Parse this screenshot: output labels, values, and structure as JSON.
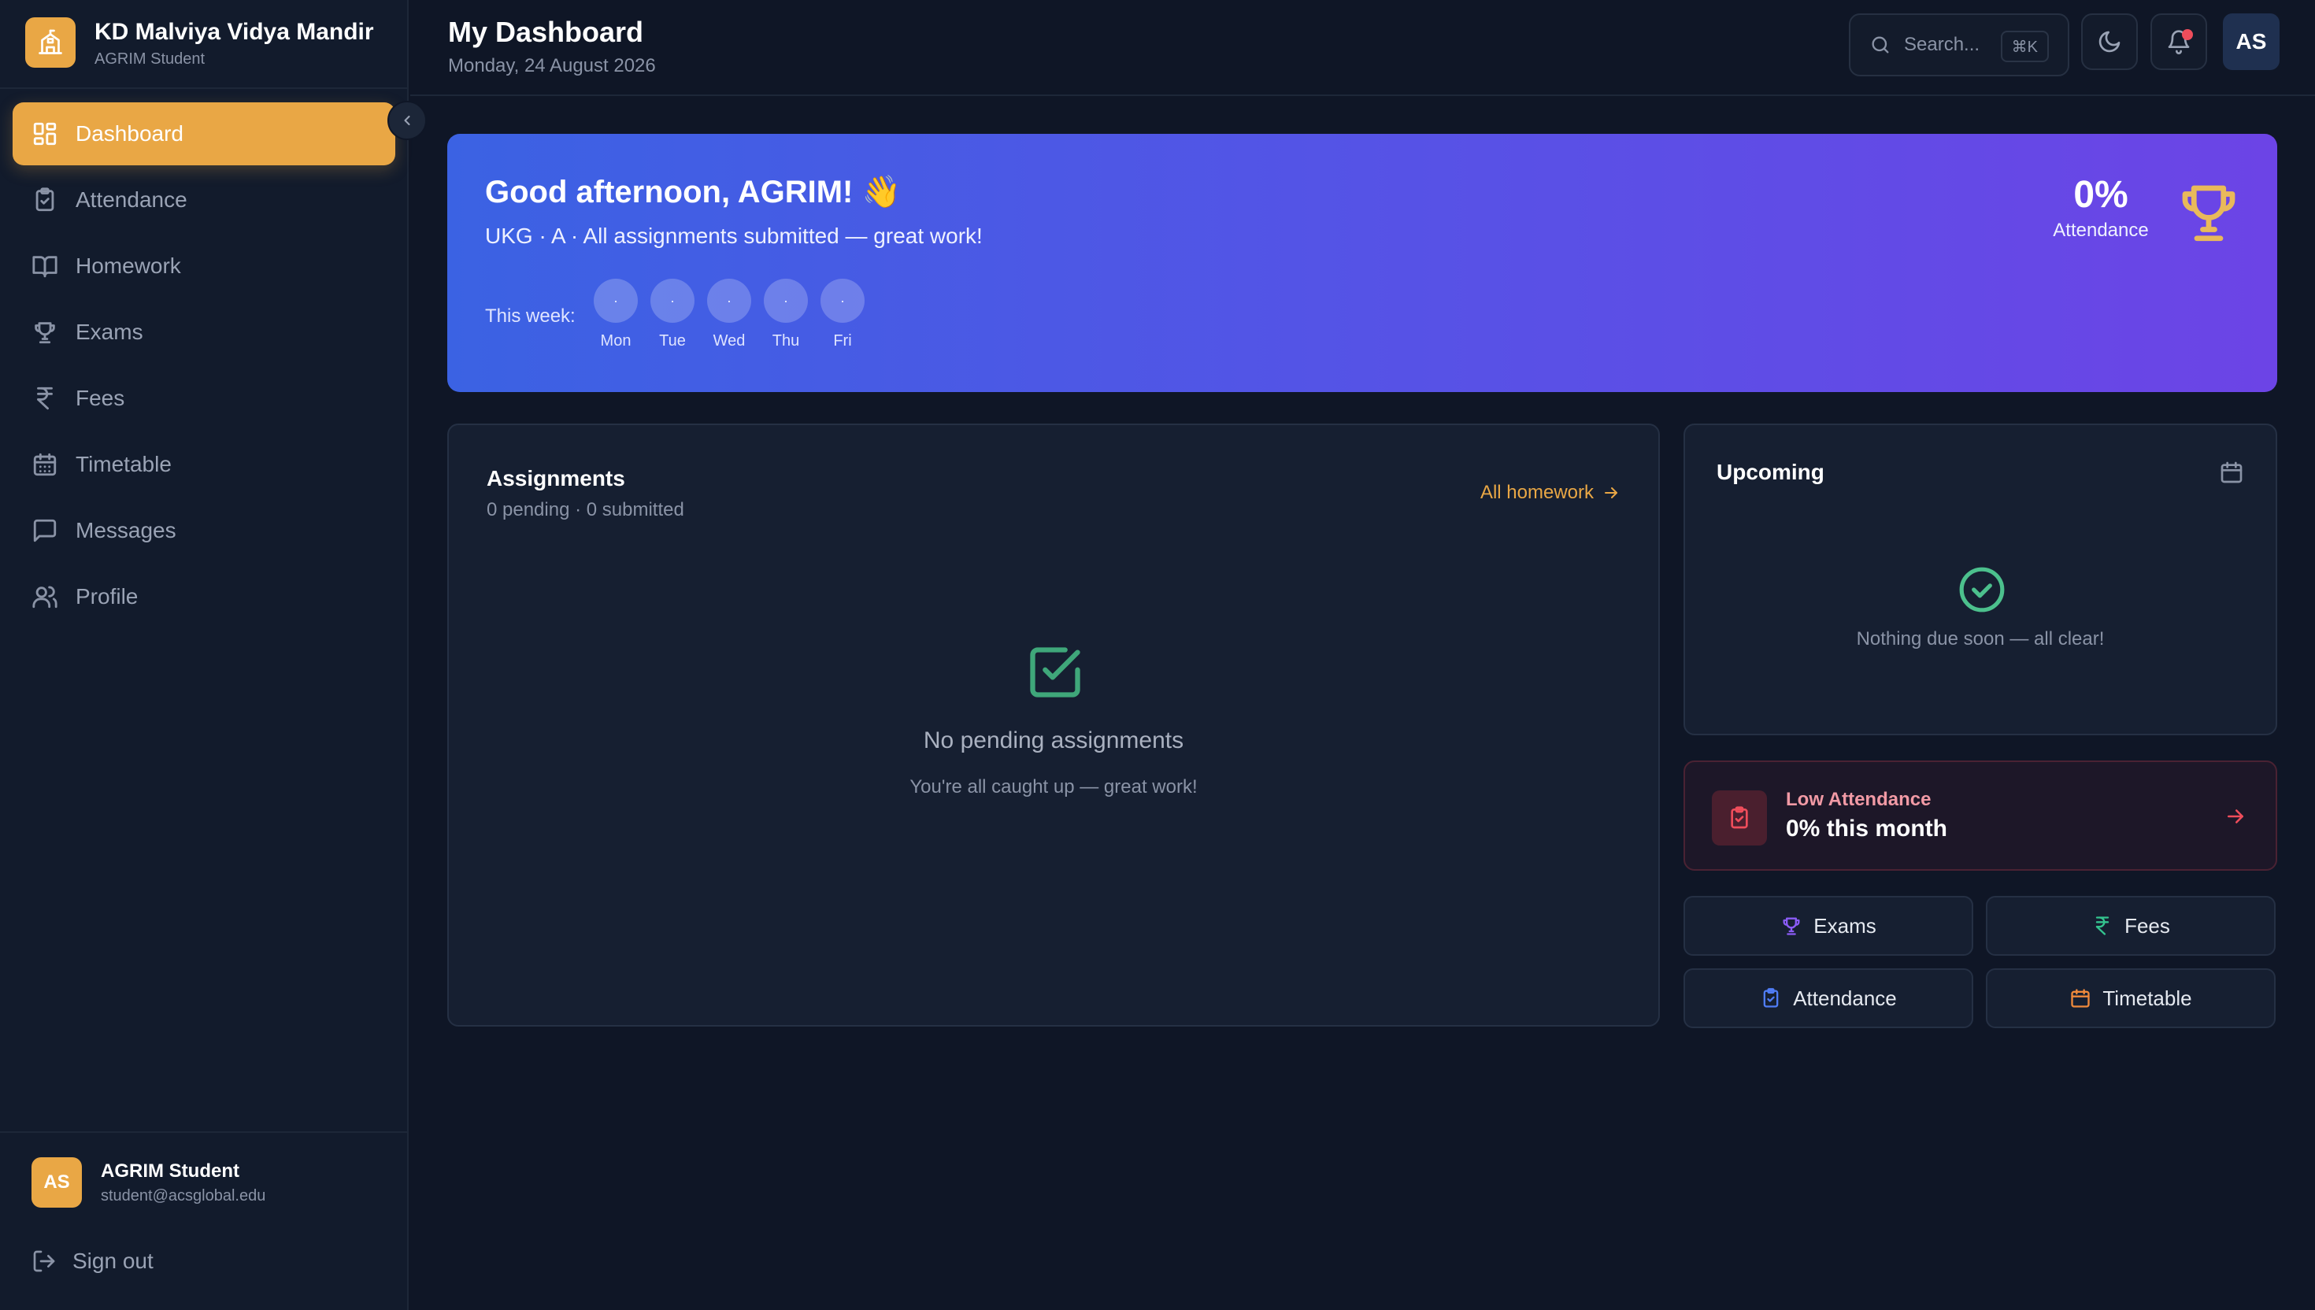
{
  "brand": {
    "name": "KD Malviya Vidya Mandir",
    "subtitle": "AGRIM Student",
    "icon": "school-icon",
    "accent": "#e9a745"
  },
  "sidebar": {
    "items": [
      {
        "label": "Dashboard",
        "icon": "dashboard-icon",
        "active": true
      },
      {
        "label": "Attendance",
        "icon": "clipboard-check-icon",
        "active": false
      },
      {
        "label": "Homework",
        "icon": "book-icon",
        "active": false
      },
      {
        "label": "Exams",
        "icon": "trophy-icon",
        "active": false
      },
      {
        "label": "Fees",
        "icon": "rupee-icon",
        "active": false
      },
      {
        "label": "Timetable",
        "icon": "calendar-icon",
        "active": false
      },
      {
        "label": "Messages",
        "icon": "message-icon",
        "active": false
      },
      {
        "label": "Profile",
        "icon": "users-icon",
        "active": false
      }
    ],
    "user": {
      "initials": "AS",
      "name": "AGRIM Student",
      "email": "student@acsglobal.edu"
    },
    "signout_label": "Sign out"
  },
  "header": {
    "title": "My Dashboard",
    "date": "Monday, 24 August 2026",
    "search_placeholder": "Search...",
    "search_shortcut": "⌘K",
    "avatar_initials": "AS",
    "has_notification": true
  },
  "hero": {
    "greeting": "Good afternoon, AGRIM! 👋",
    "subtitle": "UKG · A · All assignments submitted — great work!",
    "week_label": "This week:",
    "days": [
      {
        "label": "Mon",
        "mark": "·"
      },
      {
        "label": "Tue",
        "mark": "·"
      },
      {
        "label": "Wed",
        "mark": "·"
      },
      {
        "label": "Thu",
        "mark": "·"
      },
      {
        "label": "Fri",
        "mark": "·"
      }
    ],
    "stat_value": "0%",
    "stat_label": "Attendance",
    "gradient": [
      "#3b62e3",
      "#6c44e6"
    ]
  },
  "assignments": {
    "title": "Assignments",
    "summary": "0 pending · 0 submitted",
    "link_label": "All homework",
    "empty_title": "No pending assignments",
    "empty_subtitle": "You're all caught up — great work!"
  },
  "upcoming": {
    "title": "Upcoming",
    "empty_text": "Nothing due soon — all clear!"
  },
  "low_attendance": {
    "title": "Low Attendance",
    "value": "0% this month",
    "color": "#ef4d5b"
  },
  "quick_links": [
    {
      "label": "Exams",
      "icon": "trophy-icon",
      "color": "#8b5cf6"
    },
    {
      "label": "Fees",
      "icon": "rupee-icon",
      "color": "#34c38f"
    },
    {
      "label": "Attendance",
      "icon": "clipboard-check-icon",
      "color": "#4f7cf5"
    },
    {
      "label": "Timetable",
      "icon": "calendar-icon",
      "color": "#f08a3c"
    }
  ]
}
